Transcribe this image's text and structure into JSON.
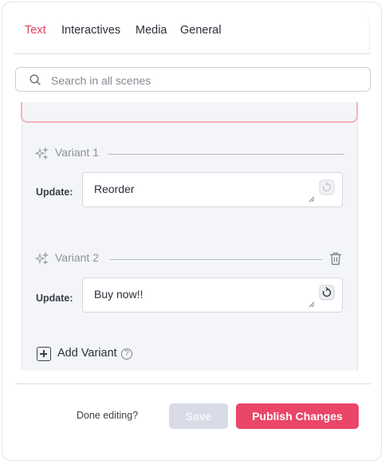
{
  "tabs": [
    {
      "label": "Text",
      "active": true
    },
    {
      "label": "Interactives",
      "active": false
    },
    {
      "label": "Media",
      "active": false
    },
    {
      "label": "General",
      "active": false
    }
  ],
  "search": {
    "placeholder": "Search in all scenes",
    "icon": "search-icon"
  },
  "variants": [
    {
      "label": "Variant 1",
      "update_label": "Update:",
      "value": "Reorder",
      "deletable": false
    },
    {
      "label": "Variant 2",
      "update_label": "Update:",
      "value": "Buy now!!",
      "deletable": true
    }
  ],
  "add_variant_label": "Add Variant",
  "help_symbol": "?",
  "footer": {
    "prompt": "Done editing?",
    "save_label": "Save",
    "publish_label": "Publish Changes"
  },
  "colors": {
    "accent": "#ea4668",
    "active_tab": "#e0405f",
    "save_disabled": "#d9dbe6",
    "card_bg": "#f4f5f9",
    "highlight_border": "#f3b3be"
  }
}
